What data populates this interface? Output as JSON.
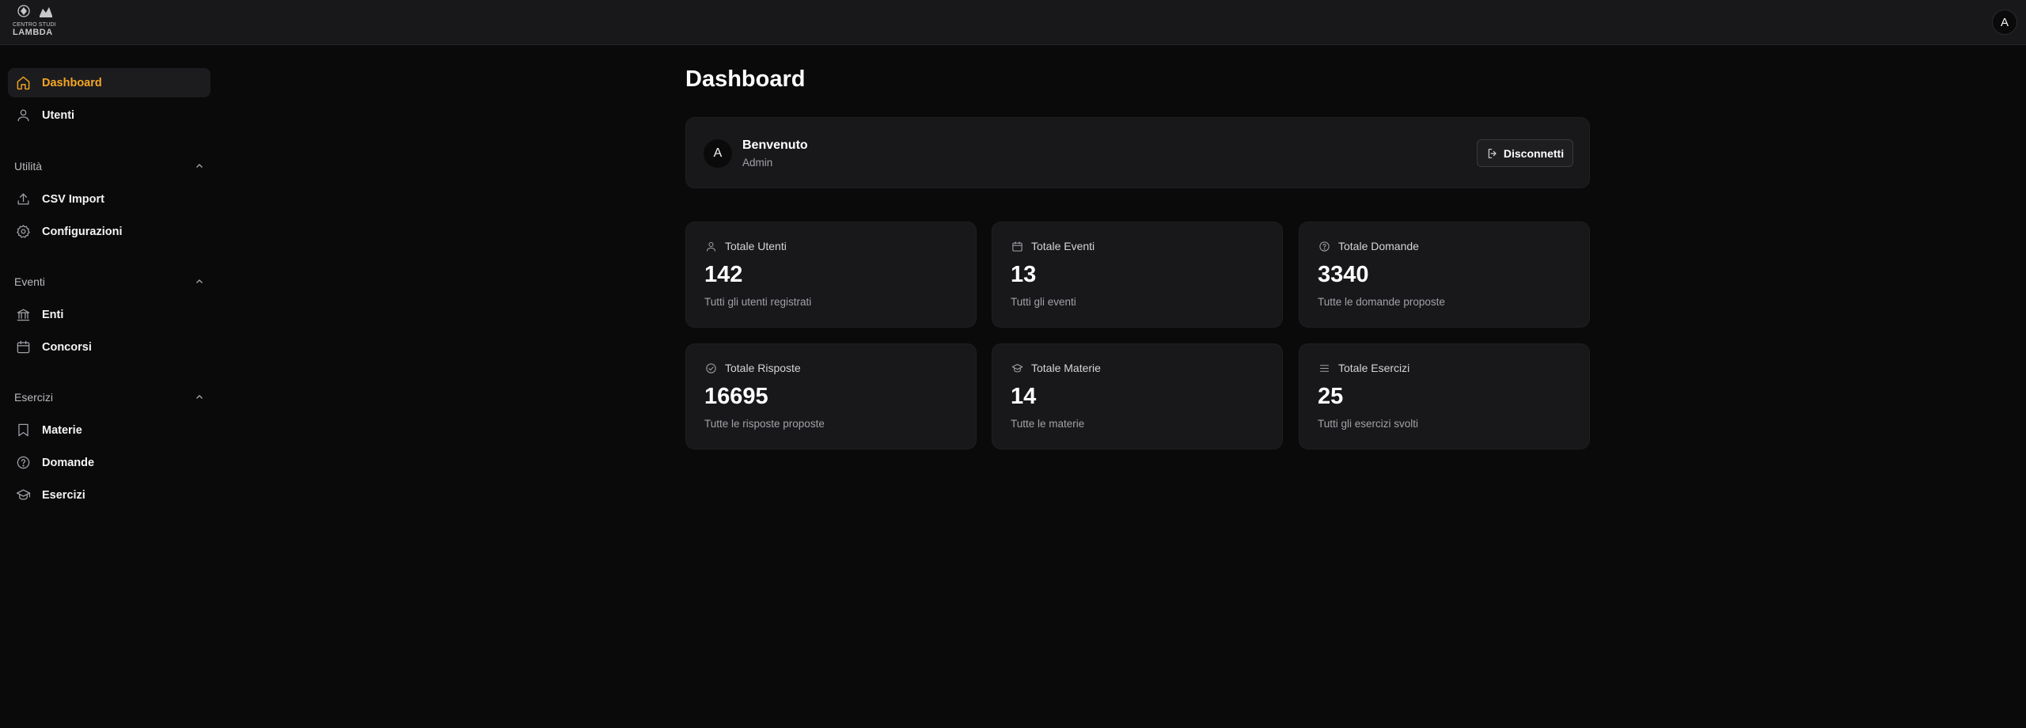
{
  "app": {
    "logo_line1": "CENTRO STUDI",
    "logo_line2": "LAMBDA",
    "user_initial": "A",
    "accent_color": "#f5a623"
  },
  "sidebar": {
    "items": [
      {
        "label": "Dashboard",
        "icon": "home-icon",
        "active": true
      },
      {
        "label": "Utenti",
        "icon": "user-icon"
      }
    ],
    "sections": [
      {
        "title": "Utilità",
        "items": [
          {
            "label": "CSV Import",
            "icon": "upload-icon"
          },
          {
            "label": "Configurazioni",
            "icon": "gear-icon"
          }
        ]
      },
      {
        "title": "Eventi",
        "items": [
          {
            "label": "Enti",
            "icon": "bank-icon"
          },
          {
            "label": "Concorsi",
            "icon": "calendar-icon"
          }
        ]
      },
      {
        "title": "Esercizi",
        "items": [
          {
            "label": "Materie",
            "icon": "bookmark-icon"
          },
          {
            "label": "Domande",
            "icon": "help-circle-icon"
          },
          {
            "label": "Esercizi",
            "icon": "graduation-cap-icon"
          }
        ]
      }
    ]
  },
  "main": {
    "title": "Dashboard",
    "welcome": {
      "initial": "A",
      "greeting": "Benvenuto",
      "role": "Admin",
      "logout_label": "Disconnetti"
    },
    "stats": [
      {
        "title": "Totale Utenti",
        "value": "142",
        "desc": "Tutti gli utenti registrati",
        "icon": "user-icon"
      },
      {
        "title": "Totale Eventi",
        "value": "13",
        "desc": "Tutti gli eventi",
        "icon": "calendar-icon"
      },
      {
        "title": "Totale Domande",
        "value": "3340",
        "desc": "Tutte le domande proposte",
        "icon": "help-circle-icon"
      },
      {
        "title": "Totale Risposte",
        "value": "16695",
        "desc": "Tutte le risposte proposte",
        "icon": "check-circle-icon"
      },
      {
        "title": "Totale Materie",
        "value": "14",
        "desc": "Tutte le materie",
        "icon": "graduation-cap-icon"
      },
      {
        "title": "Totale Esercizi",
        "value": "25",
        "desc": "Tutti gli esercizi svolti",
        "icon": "list-icon"
      }
    ]
  }
}
